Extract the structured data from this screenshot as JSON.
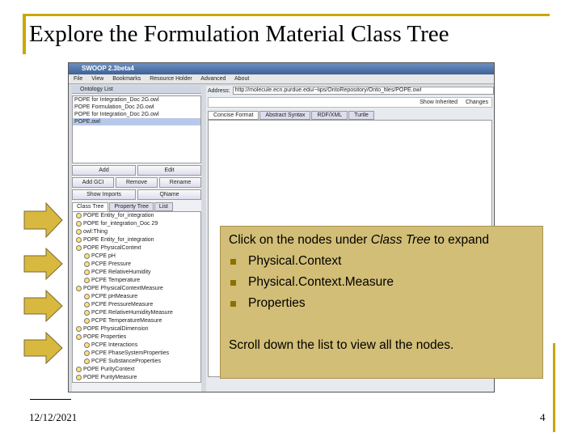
{
  "slide": {
    "title": "Explore the Formulation Material Class Tree",
    "date": "12/12/2021",
    "page": "4"
  },
  "app": {
    "window_title": "SWOOP 2.3beta4",
    "menu": [
      "File",
      "View",
      "Bookmarks",
      "Resource Holder",
      "Advanced",
      "About"
    ],
    "ontology_header": "Ontology List",
    "ontologies": [
      "POPE for Integration_Doc 2G.owl",
      "POPE Formulation_Doc 2G.owl",
      "POPE for Integration_Doc 2G.owl",
      "POPE.owl"
    ],
    "buttons_row1": [
      "Add",
      "Edit"
    ],
    "buttons_row2": [
      "Add GCI",
      "Remove",
      "Rename"
    ],
    "options": [
      "Show Imports",
      "QName"
    ],
    "tabs": [
      "Class Tree",
      "Property Tree",
      "List"
    ],
    "tree": [
      "POPE Entity_for_integration",
      "POPE for_integration_Doc 29",
      "owl:Thing",
      "POPE Entity_for_integration",
      "POPE PhysicalContext",
      "PCPE pH",
      "PCPE Pressure",
      "PCPE RelativeHumidity",
      "PCPE Temperature",
      "POPE PhysicalContextMeasure",
      "PCPE pHMeasure",
      "PCPE PressureMeasure",
      "PCPE RelativeHumidityMeasure",
      "PCPE TemperatureMeasure",
      "POPE PhysicalDimension",
      "POPE Properties",
      "PCPE Interactions",
      "PCPE PhaseSystemProperties",
      "PCPE SubstanceProperties",
      "POPE PurityContext",
      "POPE PurityMeasure"
    ],
    "address_label": "Address:",
    "address_value": "http://molecule.ecn.purdue.edu/~lips/OntoRepository/Onto_files/POPE.owl",
    "right_options": [
      "Show Inherited",
      "Changes"
    ],
    "right_tabs": [
      "Concise Format",
      "Abstract Syntax",
      "RDF/XML",
      "Turtle"
    ]
  },
  "callout": {
    "intro_before": "Click on the nodes under ",
    "intro_em": "Class Tree",
    "intro_after": " to expand",
    "bullets": [
      "Physical.Context",
      "Physical.Context.Measure",
      "Properties"
    ],
    "outro": "Scroll down the list to view all the nodes."
  },
  "colors": {
    "accent": "#c8a800",
    "callout_bg": "#d2be76",
    "arrow_fill": "#d9b840",
    "bullet": "#8a7100"
  }
}
